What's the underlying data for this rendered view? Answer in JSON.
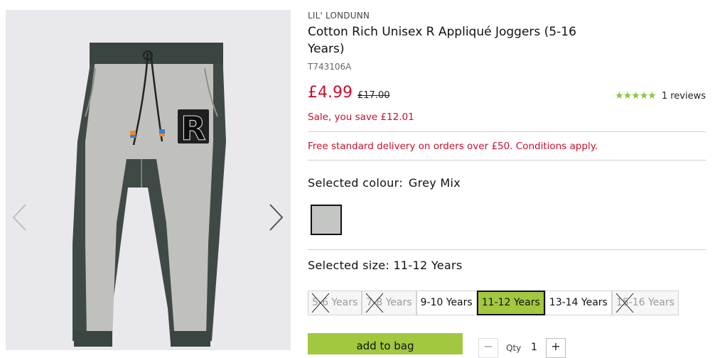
{
  "product": {
    "brand": "LIL' LONDUNN",
    "title": "Cotton Rich Unisex R Appliqué Joggers (5-16 Years)",
    "sku": "T743106A",
    "price_now": "£4.99",
    "price_was": "£17.00",
    "rating_stars": "★★★★★",
    "reviews": "1 reviews",
    "rating": 5,
    "save_text": "Sale, you save £12.01",
    "delivery_text": "Free standard delivery on orders over £50. Conditions apply."
  },
  "gallery": {
    "prev_icon": "chevron-left-icon",
    "next_icon": "chevron-right-icon",
    "applique_letter": "R"
  },
  "colour": {
    "label": "Selected colour:",
    "value": "Grey Mix",
    "swatch_color": "#c4c6c3"
  },
  "size": {
    "label": "Selected size:",
    "value": "11-12 Years",
    "options": [
      {
        "label": "5-6 Years",
        "available": false
      },
      {
        "label": "7-8 Years",
        "available": false
      },
      {
        "label": "9-10 Years",
        "available": true
      },
      {
        "label": "11-12 Years",
        "available": true,
        "selected": true
      },
      {
        "label": "13-14 Years",
        "available": true
      },
      {
        "label": "15-16 Years",
        "available": false
      }
    ]
  },
  "cart": {
    "add_label": "add to bag",
    "qty_label": "Qty",
    "qty_value": "1",
    "minus": "−",
    "plus": "+"
  },
  "colors": {
    "price_red": "#c8102e",
    "accent_green": "#a2c83f",
    "star_green": "#8cc63f"
  }
}
